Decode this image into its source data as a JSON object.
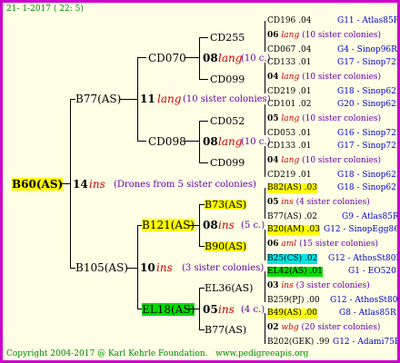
{
  "header": {
    "date": "21- 1-2017 ( 22: 5)"
  },
  "footer": {
    "copyright": "Copyright 2004-2017 @ Karl Kehrle Foundation.",
    "site": "www.pedigreeapis.org"
  },
  "colors": {
    "border": "#cc00cc",
    "background": "#ffffe6",
    "highlight_yellow": "#ffff00",
    "highlight_green": "#00dd00",
    "highlight_cyan": "#00e5e5"
  },
  "root": {
    "name": "B60(AS)",
    "num": "14",
    "label": "ins",
    "desc": "(Drones from 5 sister colonies)"
  },
  "gen1": {
    "top": {
      "name": "B77(AS)",
      "num": "11",
      "label": "lang",
      "desc": "(10 sister colonies)"
    },
    "bottom": {
      "name": "B105(AS)",
      "num": "10",
      "label": "ins",
      "desc": "(3 sister colonies)"
    }
  },
  "gen2": {
    "cd070": {
      "name": "CD070",
      "num": "08",
      "label": "lang",
      "desc": "(10 c.)"
    },
    "cd098": {
      "name": "CD098",
      "num": "08",
      "label": "lang",
      "desc": "(10 c.)"
    },
    "b121": {
      "name": "B121(AS)",
      "num": "08",
      "label": "ins",
      "desc": "(5 c.)"
    },
    "el18": {
      "name": "EL18(AS)",
      "num": "05",
      "label": "ins",
      "desc": "(4 c.)"
    }
  },
  "gen3": {
    "cd255": "CD255",
    "cd099a": "CD099",
    "cd052": "CD052",
    "cd099b": "CD099",
    "b73": "B73(AS)",
    "b90": "B90(AS)",
    "el36": "EL36(AS)",
    "b77": "B77(AS)"
  },
  "right": [
    {
      "top": "CD196 .04",
      "topref": "G11 - Atlas85R",
      "num": "06",
      "label": "lang",
      "desc": "(10 sister colonies)",
      "bot": "CD067 .04",
      "botref": "G4 - Sinop96R"
    },
    {
      "top": "CD133 .01",
      "topref": "G17 - Sinop72R",
      "num": "04",
      "label": "lang",
      "desc": "(10 sister colonies)",
      "bot": "CD219 .01",
      "botref": "G18 - Sinop62R"
    },
    {
      "top": "CD101 .02",
      "topref": "G20 - Sinop62R",
      "num": "05",
      "label": "lang",
      "desc": "(10 sister colonies)",
      "bot": "CD053 .01",
      "botref": "G16 - Sinop72R"
    },
    {
      "top": "CD133 .01",
      "topref": "G17 - Sinop72R",
      "num": "04",
      "label": "lang",
      "desc": "(10 sister colonies)",
      "bot": "CD219 .01",
      "botref": "G18 - Sinop62R"
    },
    {
      "top": "B82(AS) .03",
      "topref": "G18 - Sinop62R",
      "num": "05",
      "label": "ins",
      "desc": "(4 sister colonies)",
      "bot": "B77(AS) .02",
      "botref": "G9 - Atlas85R"
    },
    {
      "top": "B20(AM) .03",
      "topref": "G12 - SinopEgg86R",
      "num": "06",
      "label": "aml",
      "desc": "(15 sister colonies)",
      "bot": "B25(CS) .02",
      "botref": "G12 - AthosSt80R"
    },
    {
      "top": "EL42(AS) .01",
      "topref": "G1 - EO520",
      "num": "03",
      "label": "ins",
      "desc": "(3 sister colonies)",
      "bot": "B259(PJ) .00",
      "botref": "G12 - AthosSt80R"
    },
    {
      "top": "B49(AS) .00",
      "topref": "G8 - Atlas85R",
      "num": "02",
      "label": "wbg",
      "desc": "(20 sister colonies)",
      "bot": "B202(GEK) .99",
      "botref": "G12 - Adami75R"
    }
  ]
}
